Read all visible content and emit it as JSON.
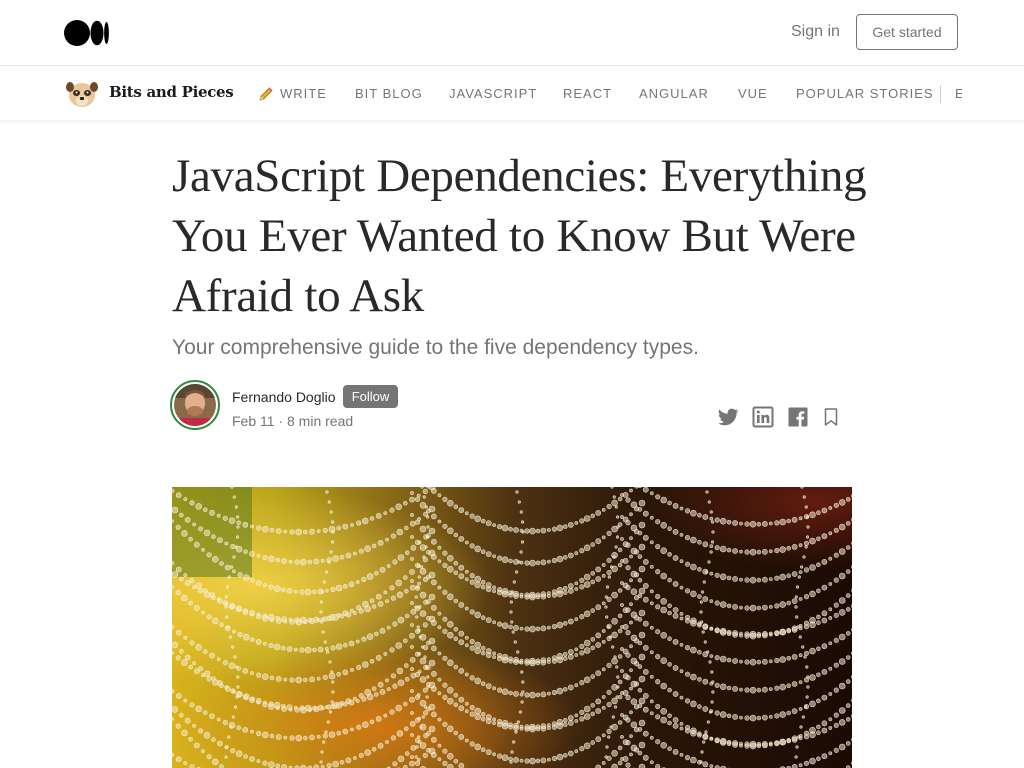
{
  "header": {
    "sign_in": "Sign in",
    "get_started": "Get started",
    "logo_icon": "medium-logo"
  },
  "publication": {
    "name": "Bits and Pieces",
    "logo_icon": "meerkat-logo",
    "nav": [
      "WRITE",
      "BIT BLOG",
      "JAVASCRIPT",
      "REACT",
      "ANGULAR",
      "VUE",
      "POPULAR STORIES",
      "E"
    ],
    "write_icon": "pencil-icon"
  },
  "article": {
    "title": "JavaScript Dependencies: Everything You Ever Wanted to Know But Were Afraid to Ask",
    "subtitle": "Your comprehensive guide to the five dependency types.",
    "author": "Fernando Doglio",
    "follow": "Follow",
    "date": "Feb 11",
    "separator": "·",
    "read_time": "8 min read",
    "share_icons": [
      "twitter-icon",
      "linkedin-icon",
      "facebook-icon",
      "bookmark-icon"
    ]
  },
  "colors": {
    "text": "#292929",
    "muted": "#757575",
    "avatar_ring": "#2f8a3f"
  }
}
